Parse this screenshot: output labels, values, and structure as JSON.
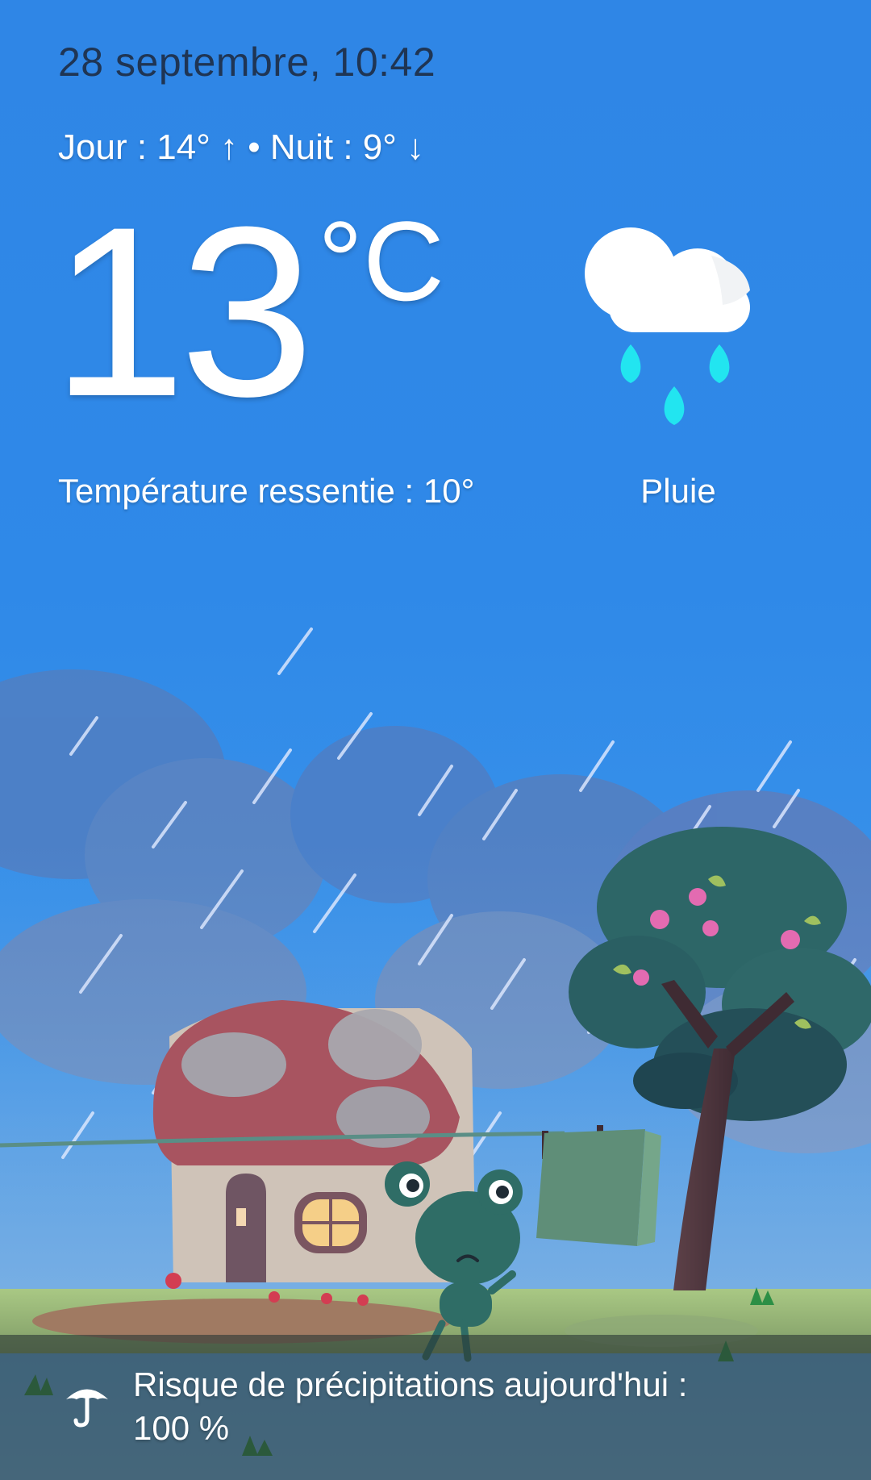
{
  "header": {
    "date_time": "28 septembre, 10:42",
    "min_max": "Jour : 14° ↑ • Nuit : 9° ↓"
  },
  "current": {
    "temperature": "13",
    "unit": "°C",
    "feels_like": "Température ressentie : 10°",
    "condition": "Pluie",
    "icon": "rain-cloud-icon"
  },
  "footer": {
    "precipitation_text": "Risque de précipitations aujourd'hui :\n100 %",
    "icon": "umbrella-icon"
  },
  "colors": {
    "sky_top": "#2f86e6",
    "sky_bottom": "#6fb1e9",
    "rain_drop": "#1ee3f1",
    "date_text": "#1f3554",
    "footer_bg": "#2b3935"
  }
}
